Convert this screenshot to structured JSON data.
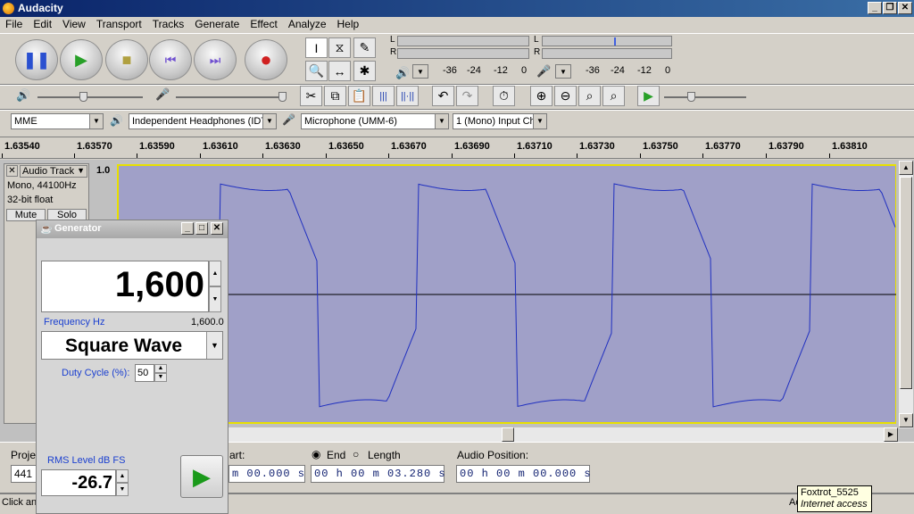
{
  "window": {
    "title": "Audacity"
  },
  "menu": [
    "File",
    "Edit",
    "View",
    "Transport",
    "Tracks",
    "Generate",
    "Effect",
    "Analyze",
    "Help"
  ],
  "meters": {
    "play": {
      "l": "L",
      "r": "R",
      "scale": [
        "-36",
        "-24",
        "-12",
        "0"
      ]
    },
    "rec": {
      "l": "L",
      "r": "R",
      "scale": [
        "-36",
        "-24",
        "-12",
        "0"
      ]
    }
  },
  "device": {
    "host": "MME",
    "output": "Independent Headphones (IDT",
    "input": "Microphone (UMM-6)",
    "channels": "1 (Mono) Input Ch"
  },
  "ruler": [
    "1.63540",
    "1.63570",
    "1.63590",
    "1.63610",
    "1.63630",
    "1.63650",
    "1.63670",
    "1.63690",
    "1.63710",
    "1.63730",
    "1.63750",
    "1.63770",
    "1.63790",
    "1.63810"
  ],
  "track": {
    "name": "Audio Track",
    "info1": "Mono, 44100Hz",
    "info2": "32-bit float",
    "mute": "Mute",
    "solo": "Solo",
    "scale_top": "1.0"
  },
  "generator": {
    "title": "Generator",
    "frequency_value": "1,600",
    "frequency_label": "Frequency Hz",
    "frequency_readout": "1,600.0",
    "waveform": "Square Wave",
    "duty_label": "Duty Cycle (%):",
    "duty_value": "50",
    "rms_label": "RMS Level dB FS",
    "rms_value": "-26.7"
  },
  "selection": {
    "project_label": "Proje",
    "project_rate": "441",
    "start_label": "art:",
    "start_time": "m 00.000 s",
    "end_label": "End",
    "length_label": "Length",
    "end_time": "00 h 00 m 03.280 s",
    "audio_position_label": "Audio Position:",
    "audio_position": "00 h 00 m 00.000 s"
  },
  "status": {
    "left": "Click an",
    "right": "Ac"
  },
  "tooltip": {
    "name": "Foxtrot_5525",
    "status": "Internet access"
  }
}
